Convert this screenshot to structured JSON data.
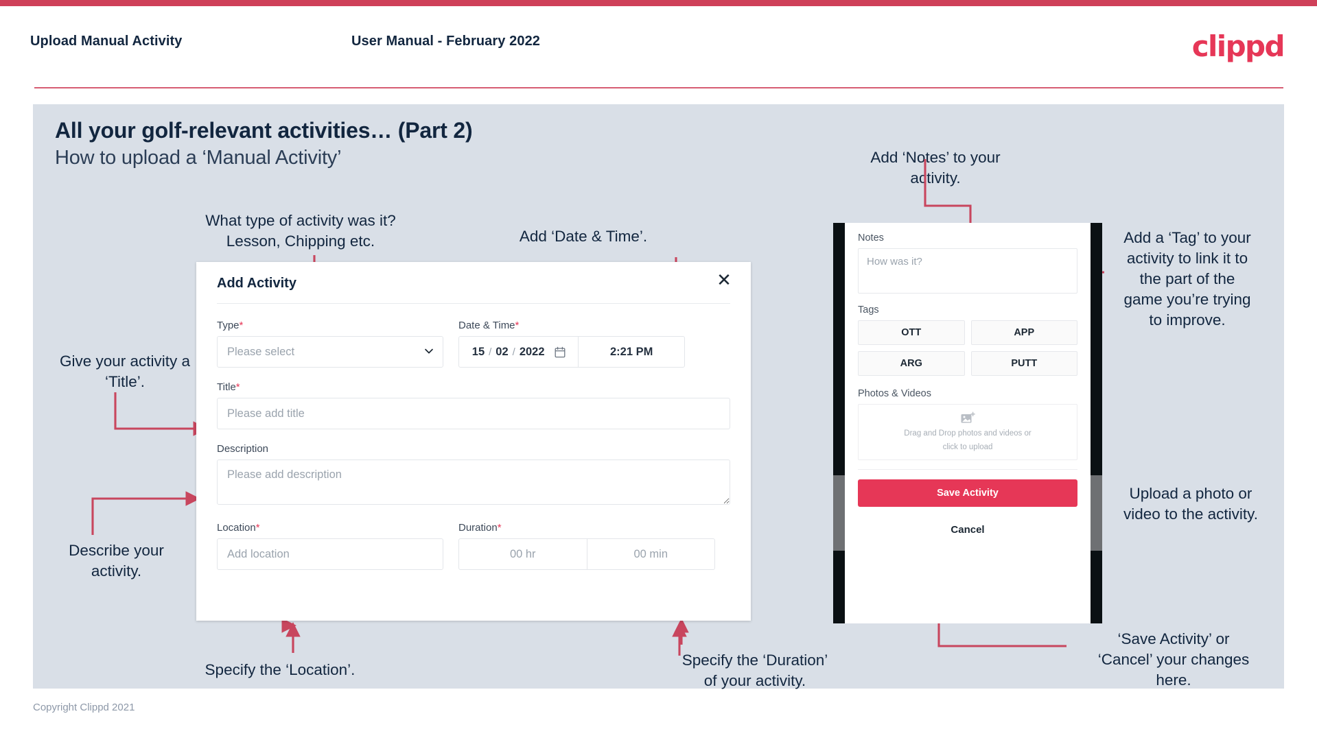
{
  "header": {
    "title": "Upload Manual Activity",
    "subtitle": "User Manual - February 2022",
    "logo": "clippd"
  },
  "slide": {
    "title": "All your golf-relevant activities… (Part 2)",
    "subtitle": "How to upload a ‘Manual Activity’",
    "footer": "Copyright Clippd 2021"
  },
  "annotations": {
    "type": "What type of activity was it?\nLesson, Chipping etc.",
    "datetime": "Add ‘Date & Time’.",
    "title": "Give your activity a\n‘Title’.",
    "description": "Describe your\nactivity.",
    "location": "Specify the ‘Location’.",
    "duration": "Specify the ‘Duration’\nof your activity.",
    "notes": "Add ‘Notes’ to your\nactivity.",
    "tags": "Add a ‘Tag’ to your\nactivity to link it to\nthe part of the\ngame you’re trying\nto improve.",
    "upload": "Upload a photo or\nvideo to the activity.",
    "save": "‘Save Activity’ or\n‘Cancel’ your changes\nhere."
  },
  "modal": {
    "title": "Add Activity",
    "close_icon": "close-icon",
    "fields": {
      "type": {
        "label": "Type",
        "required": "*",
        "placeholder": "Please select",
        "value": "",
        "chevron_icon": "chevron-down-icon"
      },
      "datetime": {
        "label": "Date & Time",
        "required": "*",
        "day": "15",
        "sep1": "/",
        "month": "02",
        "sep2": "/",
        "year": "2022",
        "calendar_icon": "calendar-icon",
        "time": "2:21 PM"
      },
      "title": {
        "label": "Title",
        "required": "*",
        "placeholder": "Please add title",
        "value": ""
      },
      "description": {
        "label": "Description",
        "required": "",
        "placeholder": "Please add description",
        "value": ""
      },
      "location": {
        "label": "Location",
        "required": "*",
        "placeholder": "Add location",
        "value": ""
      },
      "duration": {
        "label": "Duration",
        "required": "*",
        "hours_placeholder": "00 hr",
        "minutes_placeholder": "00 min"
      }
    }
  },
  "phone": {
    "notes": {
      "label": "Notes",
      "placeholder": "How was it?"
    },
    "tags": {
      "label": "Tags",
      "items": [
        "OTT",
        "APP",
        "ARG",
        "PUTT"
      ]
    },
    "media": {
      "label": "Photos & Videos",
      "icon": "add-image-icon",
      "line1": "Drag and Drop photos and videos or",
      "line2": "click to upload"
    },
    "save_label": "Save Activity",
    "cancel_label": "Cancel"
  },
  "colors": {
    "brand_pink": "#e63757",
    "accent_bar": "#cf4059",
    "slide_bg": "#d9dfe7",
    "text_dark": "#12263f",
    "arrow": "#c8465e"
  }
}
